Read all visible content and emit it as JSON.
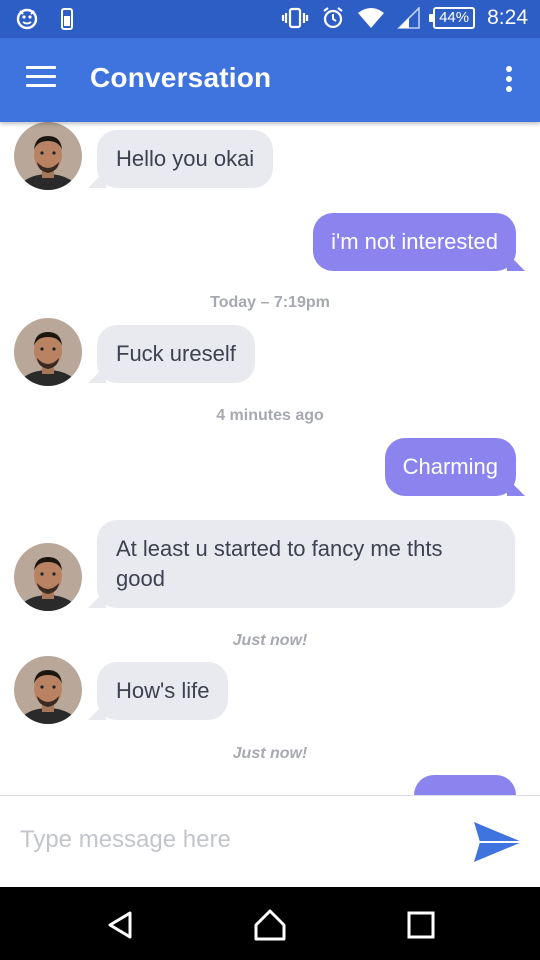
{
  "status_bar": {
    "battery": "44%",
    "time": "8:24",
    "icons": [
      "notification-icon",
      "phone-icon",
      "vibrate-icon",
      "alarm-icon",
      "wifi-icon",
      "signal-icon",
      "battery-icon"
    ]
  },
  "app_bar": {
    "title": "Conversation",
    "menu_icon": "hamburger-menu-icon",
    "more_icon": "more-vert-icon",
    "color": "#3f73dd"
  },
  "messages": [
    {
      "direction": "incoming",
      "text": "Hello you okai"
    },
    {
      "direction": "outgoing",
      "text": "i'm not interested"
    },
    {
      "type": "timestamp",
      "text": "Today – 7:19pm"
    },
    {
      "direction": "incoming",
      "text": "Fuck ureself"
    },
    {
      "type": "timestamp",
      "text": "4 minutes ago"
    },
    {
      "direction": "outgoing",
      "text": "Charming"
    },
    {
      "direction": "incoming",
      "text": "At least u started to fancy me thts good"
    },
    {
      "type": "timestamp",
      "text": "Just now!"
    },
    {
      "direction": "incoming",
      "text": "How's life"
    },
    {
      "type": "timestamp",
      "text": "Just now!"
    }
  ],
  "colors": {
    "incoming_bubble": "#e9eaef",
    "outgoing_bubble": "#8b84ef",
    "accent": "#3f73dd"
  },
  "composer": {
    "placeholder": "Type message here",
    "value": "",
    "send_icon": "send-icon"
  },
  "nav_bar": {
    "icons": [
      "back-icon",
      "home-icon",
      "recents-icon"
    ]
  }
}
